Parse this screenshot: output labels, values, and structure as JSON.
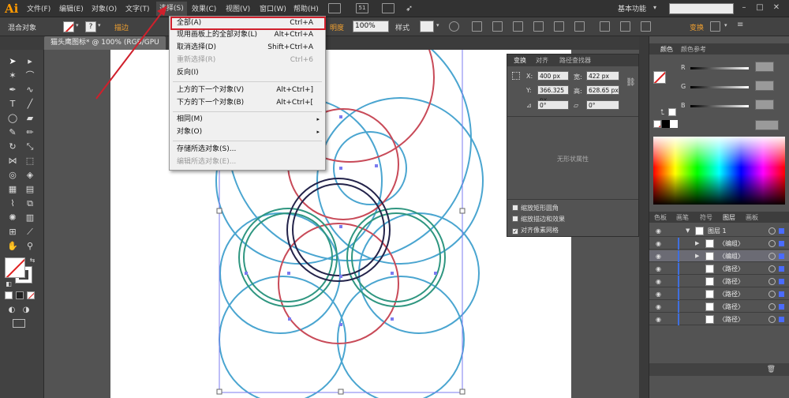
{
  "app": {
    "logo": "Ai"
  },
  "menubar": {
    "items": [
      "文件(F)",
      "编辑(E)",
      "对象(O)",
      "文字(T)",
      "选择(S)",
      "效果(C)",
      "视图(V)",
      "窗口(W)",
      "帮助(H)"
    ],
    "workspace": "基本功能",
    "badge": "51"
  },
  "controlbar": {
    "selection_label": "混合对象",
    "stroke_label": "描边",
    "opacity_label": "明度",
    "opacity_value": "100%",
    "style_label": "样式",
    "transform_label": "变换"
  },
  "document": {
    "tab_title": "猫头鹰图标* @ 100% (RGB/GPU"
  },
  "select_menu": {
    "items": [
      {
        "label": "全部(A)",
        "shortcut": "Ctrl+A",
        "disabled": false
      },
      {
        "label": "现用画板上的全部对象(L)",
        "shortcut": "Alt+Ctrl+A",
        "disabled": false
      },
      {
        "label": "取消选择(D)",
        "shortcut": "Shift+Ctrl+A",
        "disabled": false
      },
      {
        "label": "重新选择(R)",
        "shortcut": "Ctrl+6",
        "disabled": true
      },
      {
        "label": "反向(I)",
        "shortcut": "",
        "disabled": false
      },
      {
        "label": "上方的下一个对象(V)",
        "shortcut": "Alt+Ctrl+]",
        "disabled": false
      },
      {
        "label": "下方的下一个对象(B)",
        "shortcut": "Alt+Ctrl+[",
        "disabled": false
      },
      {
        "label": "相同(M)",
        "shortcut": "",
        "disabled": false
      },
      {
        "label": "对象(O)",
        "shortcut": "",
        "disabled": false
      },
      {
        "label": "存储所选对象(S)...",
        "shortcut": "",
        "disabled": false
      },
      {
        "label": "编辑所选对象(E)...",
        "shortcut": "",
        "disabled": true
      }
    ],
    "submenu_arrow": "▸"
  },
  "transform_panel": {
    "tabs": [
      "变换",
      "对齐",
      "路径查找器"
    ],
    "x_label": "X:",
    "x_value": "400 px",
    "y_label": "Y:",
    "y_value": "366.325 px",
    "w_label": "宽:",
    "w_value": "422 px",
    "h_label": "高:",
    "h_value": "628.65 px",
    "angle_value": "0°",
    "shear_value": "0°",
    "no_shape_text": "无形状属性",
    "checkboxes": [
      {
        "label": "缩放矩形圆角",
        "checked": false
      },
      {
        "label": "缩放描边和效果",
        "checked": false
      },
      {
        "label": "对齐像素网格",
        "checked": true
      }
    ],
    "check_mark": "✓"
  },
  "color_panel": {
    "tabs": [
      "颜色",
      "颜色参考"
    ],
    "channels": [
      "R",
      "G",
      "B"
    ]
  },
  "layers_panel": {
    "tabs": [
      "色板",
      "画笔",
      "符号",
      "图层",
      "画板"
    ],
    "rows": [
      {
        "name": "图层 1",
        "expanded": true,
        "selected": false
      },
      {
        "name": "〈编组〉",
        "expanded": false,
        "selected": false
      },
      {
        "name": "〈编组〉",
        "expanded": false,
        "selected": true
      },
      {
        "name": "〈路径〉",
        "expanded": false,
        "selected": false
      },
      {
        "name": "〈路径〉",
        "expanded": false,
        "selected": false
      },
      {
        "name": "〈路径〉",
        "expanded": false,
        "selected": false
      },
      {
        "name": "〈路径〉",
        "expanded": false,
        "selected": false
      },
      {
        "name": "〈路径〉",
        "expanded": false,
        "selected": false
      }
    ]
  },
  "colors": {
    "accent_red": "#d0202c",
    "circle_blue": "#4aa5d0",
    "circle_red": "#c84a58",
    "circle_green": "#2f9680",
    "circle_navy": "#23234a",
    "selection": "#7b7bf0"
  }
}
